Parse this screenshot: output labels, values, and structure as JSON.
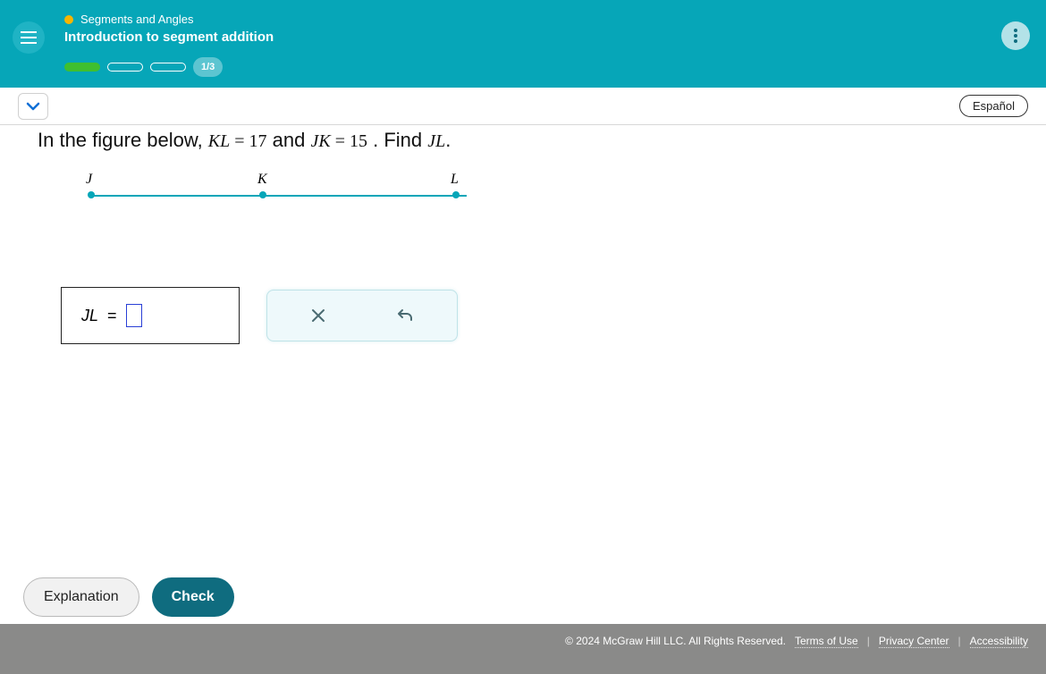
{
  "header": {
    "topic": "Segments and Angles",
    "title": "Introduction to segment addition",
    "progress_label": "1/3"
  },
  "subheader": {
    "language_label": "Español"
  },
  "question": {
    "lead": "In the figure below, ",
    "eq1_lhs": "KL",
    "eq1_op": " = ",
    "eq1_rhs": "17",
    "mid": " and ",
    "eq2_lhs": "JK",
    "eq2_op": " = ",
    "eq2_rhs": "15",
    "tail1": ". Find ",
    "target": "JL",
    "tail2": "."
  },
  "figure": {
    "points": [
      "J",
      "K",
      "L"
    ]
  },
  "answer": {
    "label_var": "JL",
    "label_eq": " = "
  },
  "buttons": {
    "explanation": "Explanation",
    "check": "Check"
  },
  "footer": {
    "copyright": "© 2024 McGraw Hill LLC. All Rights Reserved.",
    "terms": "Terms of Use",
    "privacy": "Privacy Center",
    "accessibility": "Accessibility"
  }
}
